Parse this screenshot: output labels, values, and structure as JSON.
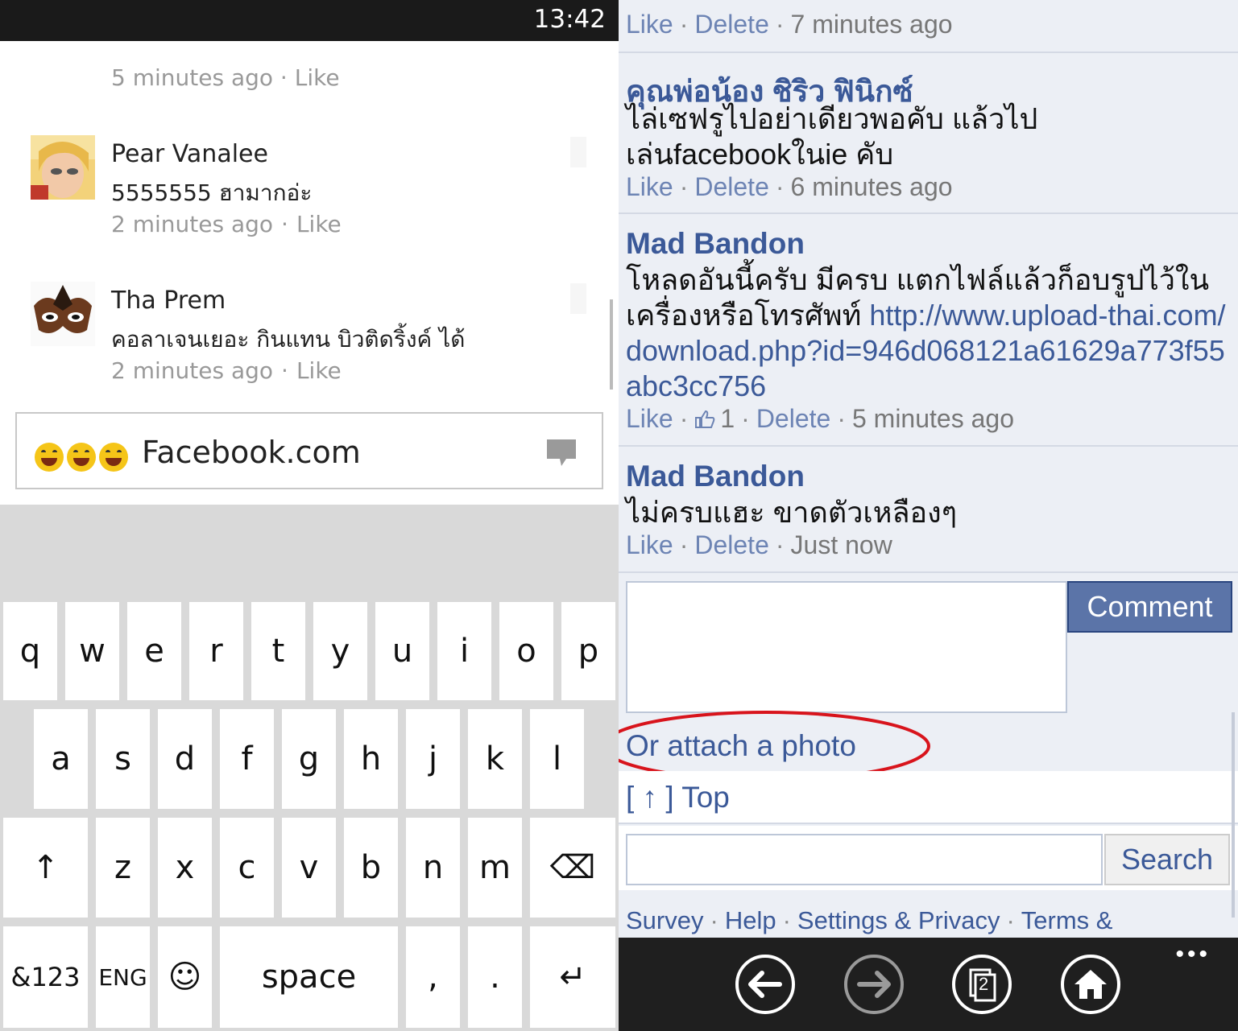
{
  "left": {
    "clock": "13:42",
    "cut_comment": "5 minutes ago · Like",
    "comments": [
      {
        "name": "Pear Vanalee",
        "text": "5555555 ฮามากอ่ะ",
        "time": "2 minutes ago",
        "like": "Like"
      },
      {
        "name": "Tha Prem",
        "text": "คอลาเจนเยอะ กินแทน บิวติดริ้งค์ ได้",
        "time": "2 minutes ago",
        "like": "Like"
      }
    ],
    "input": {
      "value": "Facebook.com",
      "emoji_icon": "laughing-emoji"
    },
    "keyboard": {
      "row1": [
        "q",
        "w",
        "e",
        "r",
        "t",
        "y",
        "u",
        "i",
        "o",
        "p"
      ],
      "row2": [
        "a",
        "s",
        "d",
        "f",
        "g",
        "h",
        "j",
        "k",
        "l"
      ],
      "row3": [
        "z",
        "x",
        "c",
        "v",
        "b",
        "n",
        "m"
      ],
      "shift": "↑",
      "backspace": "⌫",
      "symbols": "&123",
      "lang": "ENG",
      "emoji": "☺",
      "space": "space",
      "comma": ",",
      "period": ".",
      "enter": "↵"
    }
  },
  "right": {
    "partial": {
      "like": "Like",
      "delete": "Delete",
      "time": "7 minutes ago"
    },
    "comments": [
      {
        "name": "คุณพ่อน้อง ชิริว ฟินิกซ์",
        "text": "ไล่เซฟรูไปอย่าเดียวพอคับ แล้วไปเล่นfacebookในie คับ",
        "like": "Like",
        "delete": "Delete",
        "time": "6 minutes ago"
      },
      {
        "name": "Mad Bandon",
        "text": "โหลดอันนี้ครับ มีครบ แตกไฟล์แล้วก็อบรูปไว้ในเครื่องหรือโทรศัพท์",
        "link": "http://www.upload-thai.com/download.php?id=946d068121a61629a773f55abc3cc756",
        "like": "Like",
        "likes_count": "1",
        "delete": "Delete",
        "time": "5 minutes ago"
      },
      {
        "name": "Mad Bandon",
        "text": "ไม่ครบแฮะ ขาดตัวเหลืองๆ",
        "like": "Like",
        "delete": "Delete",
        "time": "Just now"
      }
    ],
    "comment_button": "Comment",
    "attach_photo": "Or attach a photo",
    "top_link": "[ ↑ ] Top",
    "search_button": "Search",
    "footer": [
      "Survey",
      "Help",
      "Settings & Privacy",
      "Terms &"
    ],
    "appbar": {
      "icons": [
        "back-icon",
        "forward-icon",
        "tabs-icon",
        "home-icon"
      ],
      "tabs_count": "2",
      "more": "•••"
    },
    "highlight_color": "#d8141c"
  }
}
